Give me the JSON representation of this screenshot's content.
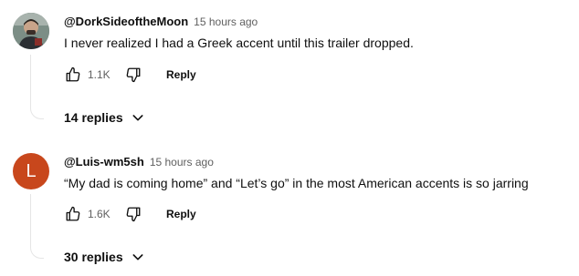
{
  "comments": [
    {
      "author": "@DorkSideoftheMoon",
      "time": "15 hours ago",
      "text": "I never realized I had a Greek accent until this trailer dropped.",
      "likes": "1.1K",
      "reply_label": "Reply",
      "replies_label": "14 replies",
      "avatar": {
        "type": "photo"
      }
    },
    {
      "author": "@Luis-wm5sh",
      "time": "15 hours ago",
      "text": "“My dad is coming home” and “Let’s go” in the most American accents is so jarring",
      "likes": "1.6K",
      "reply_label": "Reply",
      "replies_label": "30 replies",
      "avatar": {
        "type": "letter",
        "letter": "L",
        "color": "#c8471c"
      }
    }
  ],
  "icons": {
    "like": "thumbs-up-icon",
    "dislike": "thumbs-down-icon",
    "expand": "chevron-down-icon"
  },
  "colors": {
    "text": "#0f0f0f",
    "secondary": "#606060",
    "thread": "#e5e5e5"
  }
}
